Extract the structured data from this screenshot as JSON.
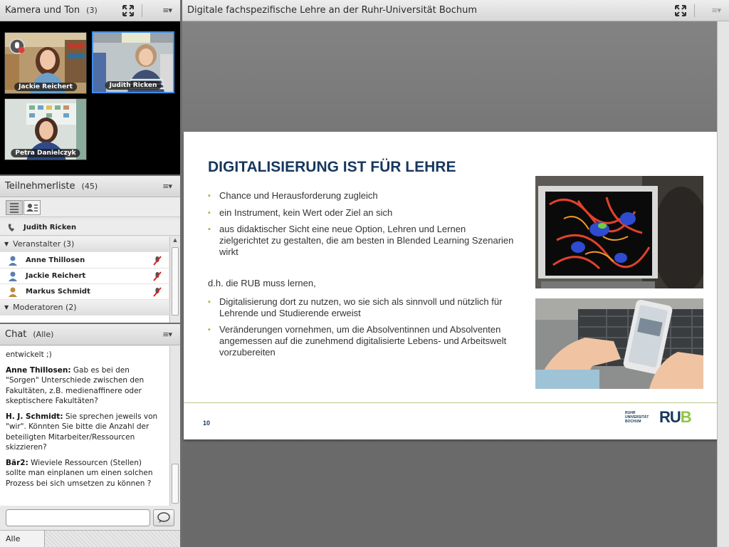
{
  "camera_pod": {
    "title": "Kamera und Ton",
    "count": "(3)",
    "participants": [
      {
        "name": "Jackie Reichert",
        "active": false
      },
      {
        "name": "Judith Ricken",
        "active": true
      },
      {
        "name": "Petra Danielczyk",
        "active": false
      }
    ]
  },
  "participants_pod": {
    "title": "Teilnehmerliste",
    "count": "(45)",
    "speaker": "Judith Ricken",
    "groups": [
      {
        "label": "Veranstalter (3)",
        "members": [
          "Anne Thillosen",
          "Jackie Reichert",
          "Markus Schmidt"
        ]
      },
      {
        "label": "Moderatoren (2)",
        "members": []
      }
    ]
  },
  "chat_pod": {
    "title": "Chat",
    "scope": "(Alle)",
    "messages": [
      {
        "author": "",
        "text": "entwickelt ;)"
      },
      {
        "author": "Anne Thillosen:",
        "text": " Gab es bei den \"Sorgen\" Unterschiede zwischen den Fakultäten, z.B. medienaffinere oder skeptischere Fakultäten?"
      },
      {
        "author": "H. J. Schmidt:",
        "text": " Sie sprechen jeweils von \"wir\". Könnten Sie bitte die Anzahl der beteiligten Mitarbeiter/Ressourcen skizzieren?"
      },
      {
        "author": "Bär2:",
        "text": " Wieviele Ressourcen (Stellen) sollte man einplanen um einen solchen Prozess bei sich umsetzen zu können ?"
      }
    ],
    "input_placeholder": "",
    "recipient": "Alle"
  },
  "share_pod": {
    "title": "Digitale fachspezifische Lehre an der Ruhr-Universität Bochum",
    "slide": {
      "heading": "DIGITALISIERUNG IST FÜR LEHRE",
      "bullets_top": [
        "Chance und Herausforderung zugleich",
        "ein Instrument, kein Wert oder Ziel an sich",
        "aus didaktischer Sicht eine neue Option, Lehren und Lernen zielgerichtet zu gestalten, die am besten in Blended Learning Szenarien wirkt"
      ],
      "subheading": "d.h. die RUB muss lernen,",
      "bullets_bottom": [
        "Digitalisierung dort zu nutzen, wo sie sich als sinnvoll und nützlich für Lehrende und Studierende erweist",
        "Veränderungen vornehmen, um die Absolventinnen und Absolventen angemessen auf die zunehmend digitalisierte Lebens- und Arbeitswelt vorzubereiten"
      ],
      "page_number": "10",
      "logo_small": "RUHR\nUNIVERSITÄT\nBOCHUM",
      "logo_main": "RU",
      "logo_main_accent": "B"
    }
  },
  "colors": {
    "slide_heading": "#17375e",
    "bullet_accent": "#8dc63f",
    "active_tile_border": "#3d8ce6"
  }
}
